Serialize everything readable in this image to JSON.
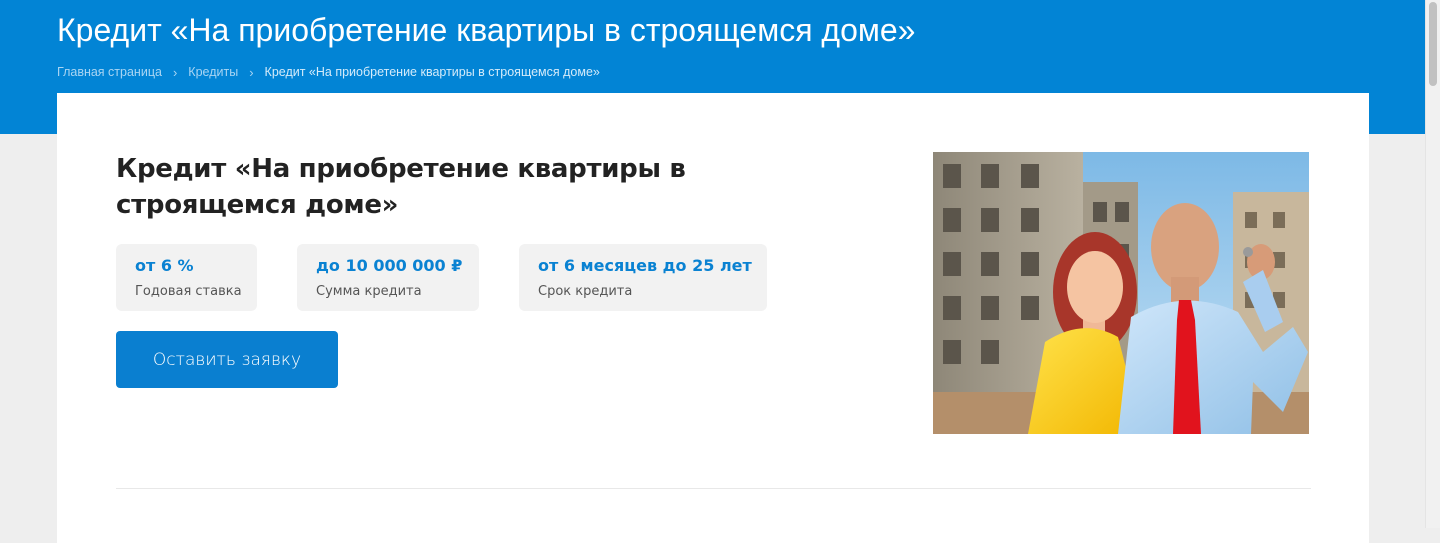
{
  "header": {
    "title": "Кредит «На приобретение квартиры в строящемся доме»",
    "background_color": "#0284d5"
  },
  "breadcrumb": {
    "items": [
      "Главная страница",
      "Кредиты",
      "Кредит «На приобретение квартиры в строящемся доме»"
    ],
    "separator": "›"
  },
  "product": {
    "title": "Кредит «На приобретение квартиры в строящемся доме»",
    "stats": [
      {
        "value": "от 6 %",
        "label": "Годовая ставка"
      },
      {
        "value": "до 10 000 000 ₽",
        "label": "Сумма кредита"
      },
      {
        "value": "от 6 месяцев до 25 лет",
        "label": "Срок кредита"
      }
    ],
    "cta_label": "Оставить заявку",
    "accent_color": "#0a82d2"
  },
  "photo": {
    "icon": "couple-with-keys-photo"
  }
}
